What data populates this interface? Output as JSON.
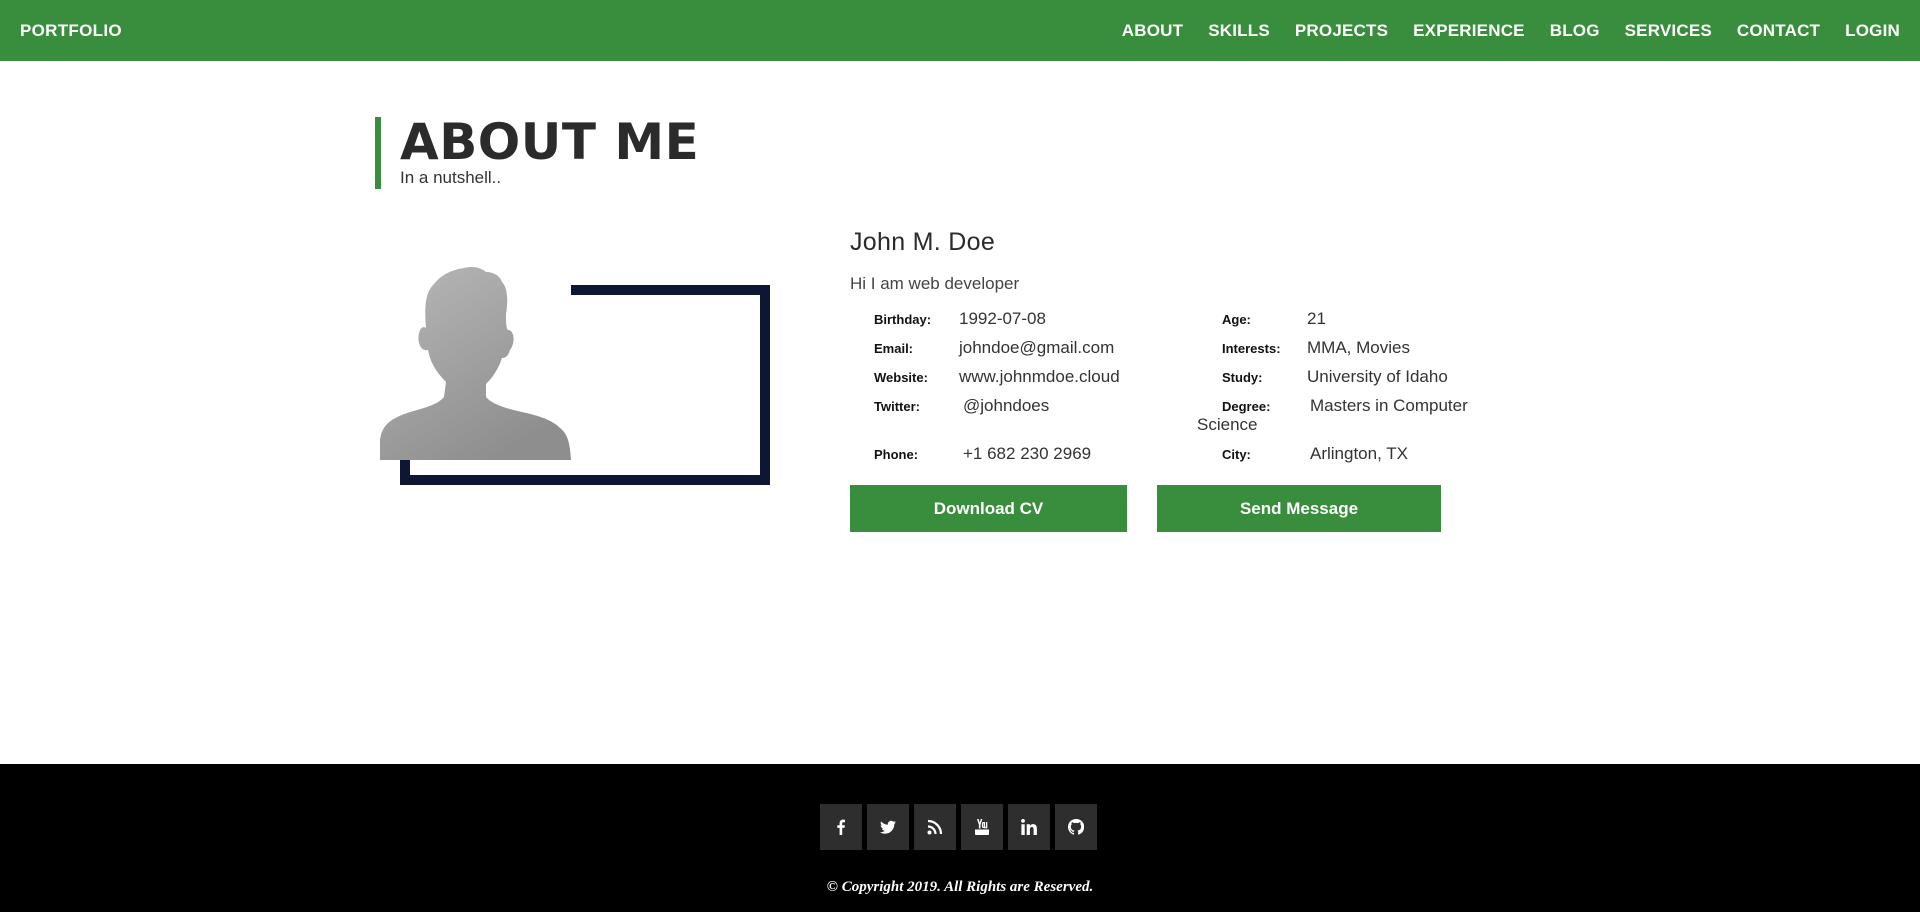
{
  "nav": {
    "brand": "PORTFOLIO",
    "links": [
      "ABOUT",
      "SKILLS",
      "PROJECTS",
      "EXPERIENCE",
      "BLOG",
      "SERVICES",
      "CONTACT",
      "LOGIN"
    ]
  },
  "section": {
    "title": "ABOUT ME",
    "subtitle": "In a nutshell.."
  },
  "profile": {
    "name": "John M. Doe",
    "tagline": "Hi I am web developer",
    "left": [
      {
        "label": "Birthday:",
        "value": "1992-07-08"
      },
      {
        "label": "Email:",
        "value": "johndoe@gmail.com"
      },
      {
        "label": "Website:",
        "value": "www.johnmdoe.cloud"
      },
      {
        "label": "Twitter:",
        "value": "@johndoes"
      },
      {
        "label": "Phone:",
        "value": "+1 682 230 2969"
      }
    ],
    "right": [
      {
        "label": "Age:",
        "value": "21"
      },
      {
        "label": "Interests:",
        "value": "MMA, Movies"
      },
      {
        "label": "Study:",
        "value": "University of Idaho"
      },
      {
        "label": "Degree:",
        "value": "Masters in Computer",
        "value2": "Science"
      },
      {
        "label": "City:",
        "value": "Arlington, TX"
      }
    ]
  },
  "buttons": {
    "download": "Download CV",
    "message": "Send Message"
  },
  "footer": {
    "icons": [
      "facebook-icon",
      "twitter-icon",
      "rss-icon",
      "youtube-icon",
      "linkedin-icon",
      "github-icon"
    ],
    "copyright": "© Copyright 2019. All Rights are Reserved."
  },
  "colors": {
    "primary": "#388e3c",
    "frame": "#0d1733",
    "footer": "#000000"
  }
}
